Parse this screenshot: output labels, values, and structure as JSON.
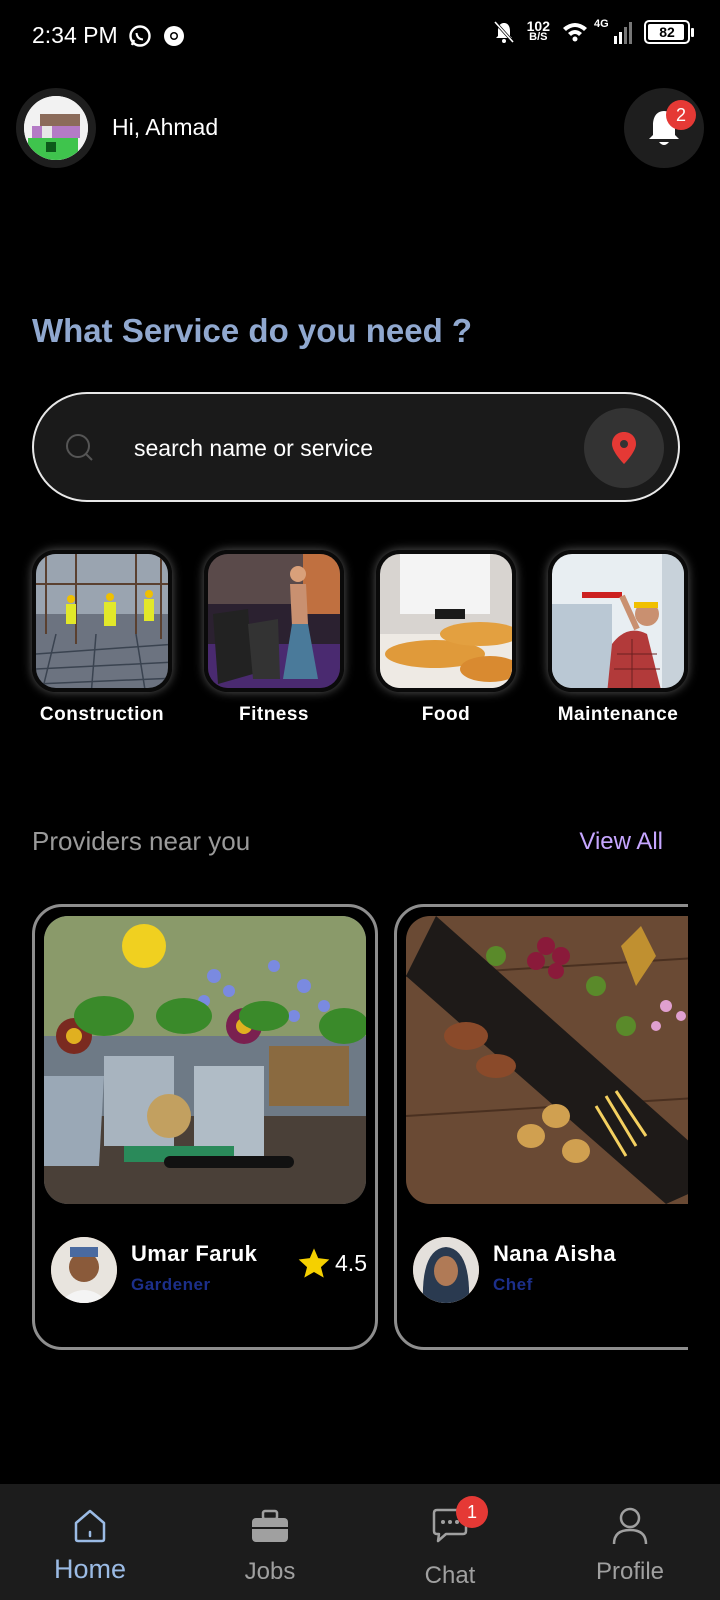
{
  "status_bar": {
    "time": "2:34 PM",
    "net_speed_value": "102",
    "net_speed_unit": "B/S",
    "network_type": "4G",
    "battery": "82"
  },
  "header": {
    "greeting": "Hi, Ahmad",
    "notification_count": "2"
  },
  "headline": "What Service do you need ?",
  "search": {
    "placeholder": "search name or service"
  },
  "categories": [
    {
      "label": "Construction"
    },
    {
      "label": "Fitness"
    },
    {
      "label": "Food"
    },
    {
      "label": "Maintenance"
    }
  ],
  "providers_section": {
    "title": "Providers near you",
    "view_all": "View All"
  },
  "providers": [
    {
      "name": "Umar Faruk",
      "role": "Gardener",
      "rating": "4.5"
    },
    {
      "name": "Nana Aisha",
      "role": "Chef",
      "rating": ""
    }
  ],
  "bottom_nav": {
    "items": [
      {
        "label": "Home",
        "icon": "home-icon",
        "active": true
      },
      {
        "label": "Jobs",
        "icon": "briefcase-icon"
      },
      {
        "label": "Chat",
        "icon": "chat-icon",
        "badge": "1"
      },
      {
        "label": "Profile",
        "icon": "user-icon"
      }
    ]
  },
  "colors": {
    "accent_blue": "#90a8cf",
    "view_all": "#c6a6ff",
    "badge_red": "#e53935",
    "role_blue": "#1c2f8a",
    "star": "#f5d000"
  }
}
